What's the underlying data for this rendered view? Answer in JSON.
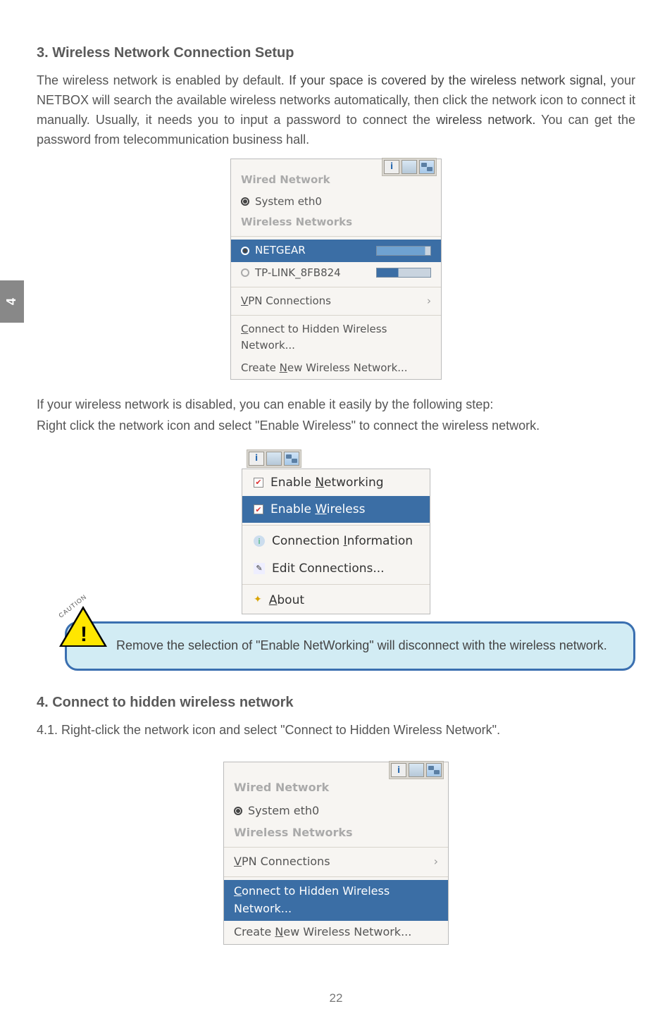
{
  "sidebar_chapter": "4",
  "section3": {
    "title": "3. Wireless Network Connection Setup",
    "p1_a": "The wireless network is enabled by default. ",
    "p1_b": "If your space is covered by the wireless network signal,",
    "p1_c": " your NETBOX will search the available wireless networks automatically, then click the network icon to connect it manually. Usually, it needs you to input a password to connect the ",
    "p1_d": "wireless network.",
    "p1_e": " You can get the password from telecommunication business hall.",
    "p2": "If your wireless network is disabled, you can enable it easily by the following step:",
    "p3": "Right click the network icon and select \"Enable Wireless\" to connect the wireless network."
  },
  "popup1": {
    "wired_header": "Wired Network",
    "system_eth0": "System eth0",
    "wireless_header": "Wireless Networks",
    "netgear": "NETGEAR",
    "tplink": "TP-LINK_8FB824",
    "vpn_pre": "V",
    "vpn_rest": "PN Connections",
    "connect_hidden_pre": "C",
    "connect_hidden_rest": "onnect to Hidden Wireless Network...",
    "create_new_pre": "Create ",
    "create_new_u": "N",
    "create_new_rest": "ew Wireless Network..."
  },
  "popup2": {
    "en_net_pre": "Enable ",
    "en_net_u": "N",
    "en_net_rest": "etworking",
    "en_wifi_pre": "Enable ",
    "en_wifi_u": "W",
    "en_wifi_rest": "ireless",
    "conn_info_pre": "Connection ",
    "conn_info_u": "I",
    "conn_info_rest": "nformation",
    "edit_conn": "Edit Connections...",
    "about_u": "A",
    "about_rest": "bout"
  },
  "caution": {
    "label": "CAUTION",
    "text": "Remove the selection of \"Enable NetWorking\"  will disconnect with the wireless network."
  },
  "section4": {
    "title": "4. Connect to hidden wireless network",
    "p1": "4.1. Right-click the network icon and select \"Connect to Hidden Wireless Network\"."
  },
  "popup3": {
    "wired_header": "Wired Network",
    "system_eth0": "System eth0",
    "wireless_header": "Wireless Networks",
    "vpn_pre": "V",
    "vpn_rest": "PN Connections",
    "connect_hidden_pre": "C",
    "connect_hidden_rest": "onnect to Hidden Wireless Network...",
    "create_new_pre": "Create ",
    "create_new_u": "N",
    "create_new_rest": "ew Wireless Network..."
  },
  "page_number": "22"
}
